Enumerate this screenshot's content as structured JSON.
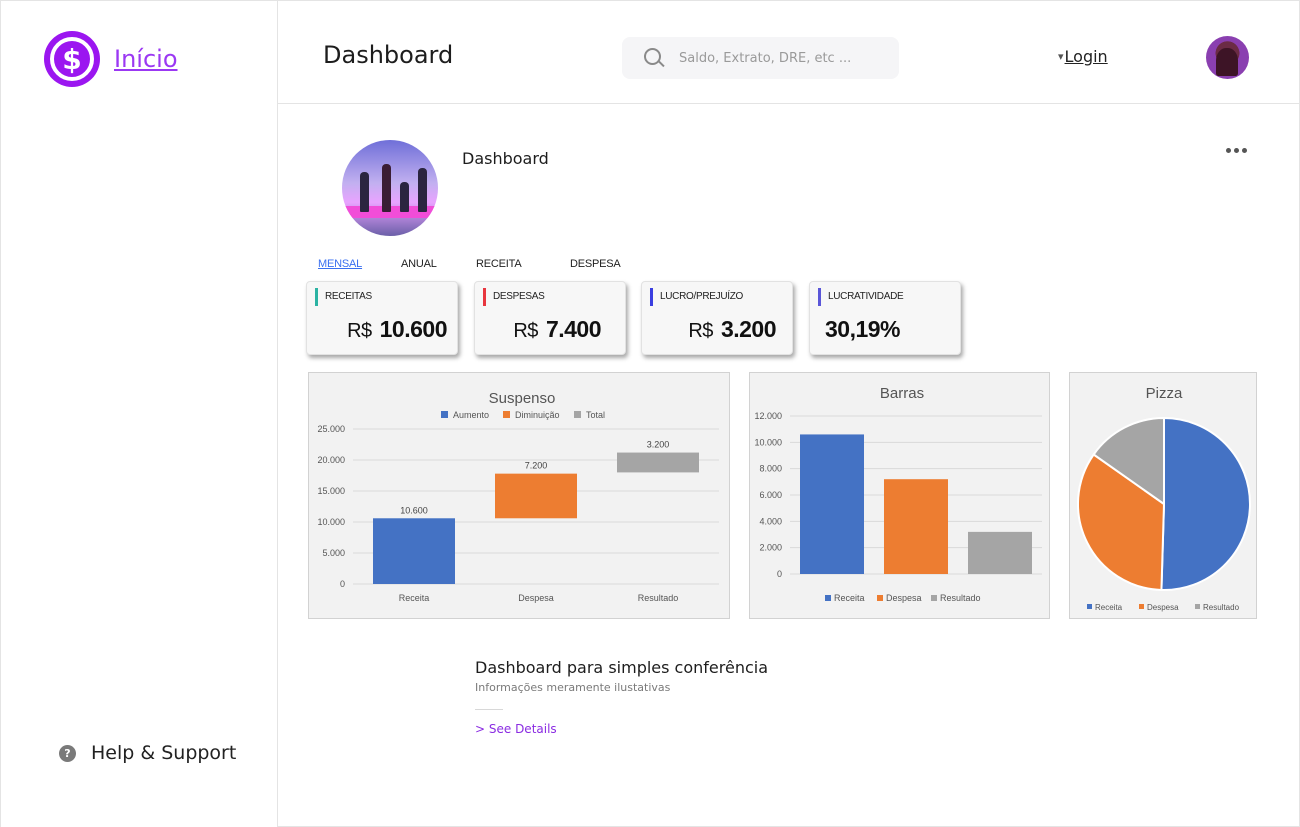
{
  "sidebar": {
    "brand_symbol": "$",
    "brand_link": "Início",
    "help_label": "Help & Support",
    "help_icon": "question-circle-icon"
  },
  "header": {
    "title": "Dashboard",
    "search_placeholder": "Saldo, Extrato, DRE, etc ...",
    "login_label": "Login",
    "login_caret": "▾"
  },
  "card": {
    "title": "Dashboard",
    "tabs": [
      "MENSAL",
      "ANUAL",
      "RECEITA",
      "DESPESA"
    ],
    "active_tab": 0,
    "kpis": [
      {
        "label": "RECEITAS",
        "currency": "R$",
        "value": "10.600",
        "color": "#2bb3a3"
      },
      {
        "label": "DESPESAS",
        "currency": "R$",
        "value": "7.400",
        "color": "#e8363e"
      },
      {
        "label": "LUCRO/PREJUÍZO",
        "currency": "R$",
        "value": "3.200",
        "color": "#3a3ee0"
      },
      {
        "label": "LUCRATIVIDADE",
        "currency": "",
        "value": "30,19%",
        "color": "#5a56d8"
      }
    ],
    "info_title": "Dashboard para simples conferência",
    "info_sub": "Informações meramente ilustativas",
    "see_details": "> See Details"
  },
  "colors": {
    "accent": "#9b16f0",
    "blue": "#4472c4",
    "orange": "#ed7d31",
    "gray": "#a5a5a5"
  },
  "chart_data": [
    {
      "type": "bar",
      "title": "Suspenso",
      "categories": [
        "Receita",
        "Despesa",
        "Resultado"
      ],
      "legend": [
        "Aumento",
        "Diminuição",
        "Total"
      ],
      "series": [
        {
          "name": "Aumento",
          "values": [
            10600,
            0,
            0
          ]
        },
        {
          "name": "Diminuição",
          "values": [
            0,
            7200,
            0
          ]
        },
        {
          "name": "Total",
          "values": [
            0,
            0,
            3200
          ]
        }
      ],
      "bar_base": [
        0,
        10600,
        18000
      ],
      "data_labels": [
        "10.600",
        "7.200",
        "3.200"
      ],
      "yticks": [
        "0",
        "5.000",
        "10.000",
        "15.000",
        "20.000",
        "25.000"
      ],
      "ylim": [
        0,
        25000
      ],
      "grid": true,
      "legend_position": "top"
    },
    {
      "type": "bar",
      "title": "Barras",
      "categories": [
        "Receita",
        "Despesa",
        "Resultado"
      ],
      "values": [
        10600,
        7200,
        3200
      ],
      "legend": [
        "Receita",
        "Despesa",
        "Resultado"
      ],
      "yticks": [
        "0",
        "2.000",
        "4.000",
        "6.000",
        "8.000",
        "10.000",
        "12.000"
      ],
      "ylim": [
        0,
        12000
      ],
      "grid": true,
      "legend_position": "bottom"
    },
    {
      "type": "pie",
      "title": "Pizza",
      "categories": [
        "Receita",
        "Despesa",
        "Resultado"
      ],
      "values": [
        10600,
        7200,
        3200
      ],
      "legend": [
        "Receita",
        "Despesa",
        "Resultado"
      ],
      "legend_position": "bottom"
    }
  ]
}
